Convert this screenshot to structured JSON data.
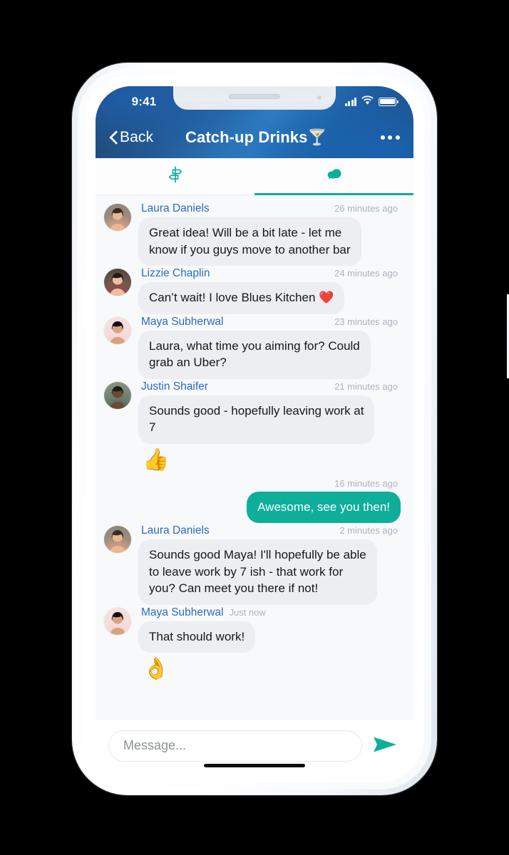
{
  "status_bar": {
    "time": "9:41",
    "signal_icon": "cellular-signal-icon",
    "wifi_icon": "wifi-icon",
    "battery_icon": "battery-icon"
  },
  "header": {
    "back_label": "Back",
    "back_icon": "chevron-left-icon",
    "title": "Catch-up Drinks",
    "title_emoji": "🍸",
    "more_icon": "more-options-icon",
    "accent_color": "#0fae9b",
    "header_gradient_from": "#20446e",
    "header_gradient_to": "#1e4f86"
  },
  "tabs": [
    {
      "name": "plans",
      "icon": "signpost-icon",
      "active": false
    },
    {
      "name": "chat",
      "icon": "chat-bubbles-icon",
      "active": true
    }
  ],
  "messages": [
    {
      "sender": "Laura Daniels",
      "time": "26 minutes ago",
      "text": "Great idea! Will be a bit late - let me\nknow if you guys move to another bar",
      "direction": "in",
      "avatar": "laura-daniels-avatar",
      "reaction": ""
    },
    {
      "sender": "Lizzie Chaplin",
      "time": "24 minutes ago",
      "text": "Can’t wait! I love Blues Kitchen ❤️",
      "direction": "in",
      "avatar": "lizzie-chaplin-avatar",
      "reaction": ""
    },
    {
      "sender": "Maya Subherwal",
      "time": "23 minutes ago",
      "text": "Laura, what time you aiming for? Could\ngrab an Uber?",
      "direction": "in",
      "avatar": "maya-subherwal-avatar",
      "reaction": ""
    },
    {
      "sender": "Justin Shaifer",
      "time": "21 minutes ago",
      "text": "Sounds good - hopefully leaving work at\n7",
      "direction": "in",
      "avatar": "justin-shaifer-avatar",
      "reaction": "👍"
    },
    {
      "sender": "",
      "time": "16 minutes ago",
      "text": "Awesome, see you then!",
      "direction": "out",
      "avatar": "",
      "reaction": ""
    },
    {
      "sender": "Laura Daniels",
      "time": "2 minutes ago",
      "text": "Sounds good Maya! I'll hopefully be able\nto leave work by 7 ish - that work for\nyou? Can meet you there if not!",
      "direction": "in",
      "avatar": "laura-daniels-avatar",
      "reaction": ""
    },
    {
      "sender": "Maya Subherwal",
      "time": "Just now",
      "text": "That should work!",
      "direction": "in",
      "avatar": "maya-subherwal-avatar",
      "reaction": "👌"
    }
  ],
  "composer": {
    "placeholder": "Message...",
    "value": "",
    "send_icon": "send-arrow-icon",
    "send_color": "#0fae9b"
  }
}
